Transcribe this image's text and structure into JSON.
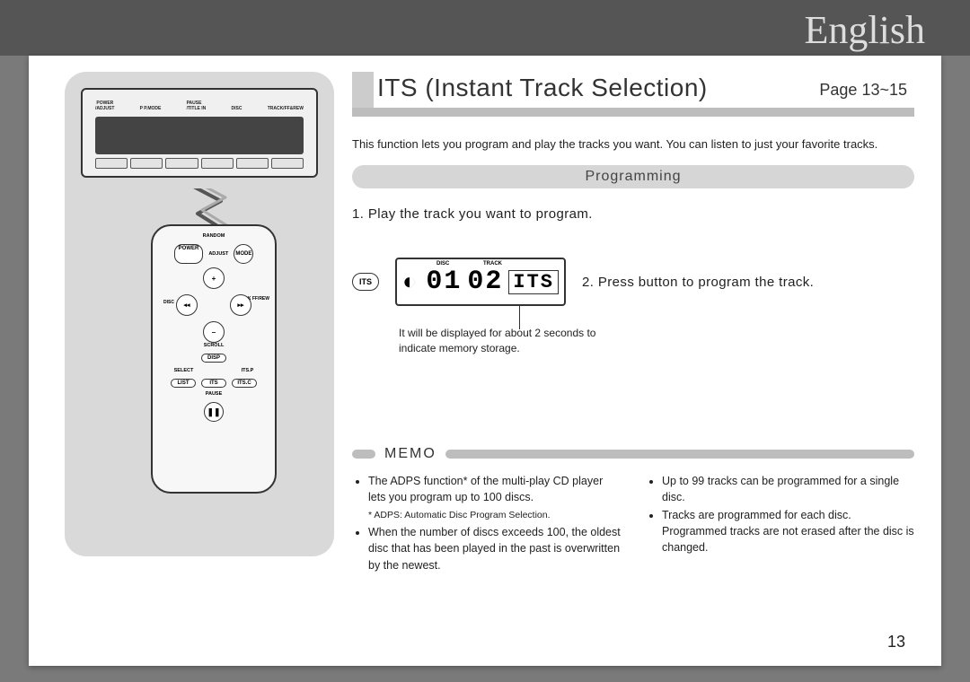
{
  "language": "English",
  "heading": {
    "title": "ITS (Instant Track Selection)",
    "page_ref": "Page 13~15"
  },
  "intro": "This function lets you program and play the tracks you want. You can listen to just your favorite tracks.",
  "subheading": "Programming",
  "step1": "1. Play the track you want to program.",
  "step2": "2. Press button to program the track.",
  "its_btn": "ITS",
  "lcd": {
    "disc_label": "DISC",
    "track_label": "TRACK",
    "disc_num": "01",
    "track_num": "02",
    "its": "ITS"
  },
  "display_note": "It will be displayed for about 2 seconds to indicate memory storage.",
  "memo": {
    "title": "MEMO",
    "left": [
      "The ADPS function* of the multi-play CD player lets you program up to 100 discs.",
      "* ADPS: Automatic Disc Program Selection.",
      "When the number of discs exceeds 100, the oldest disc that has been played in the past is overwritten by the newest."
    ],
    "right": [
      "Up to 99 tracks can be programmed for a single disc.",
      "Tracks are programmed for each disc. Programmed tracks are not erased after the disc is changed."
    ]
  },
  "page_number": "13",
  "car_unit_labels": {
    "a": " POWER\n/ADJUST",
    "b": "P P.MODE",
    "c": "PAUSE\n/TITLE IN",
    "d": "DISC",
    "e": "TRACK/FF&REW"
  },
  "remote": {
    "random": "RANDOM",
    "power": "POWER",
    "adjust": "ADJUST",
    "mode": "MODE",
    "disc": "DISC",
    "track": "TRACK\nFF/REW",
    "scroll": "SCROLL",
    "disp": "DISP",
    "select": "SELECT",
    "itsp": "ITS.P",
    "list": "LIST",
    "its": "ITS",
    "itsc": "ITS.C",
    "pause": "PAUSE"
  }
}
